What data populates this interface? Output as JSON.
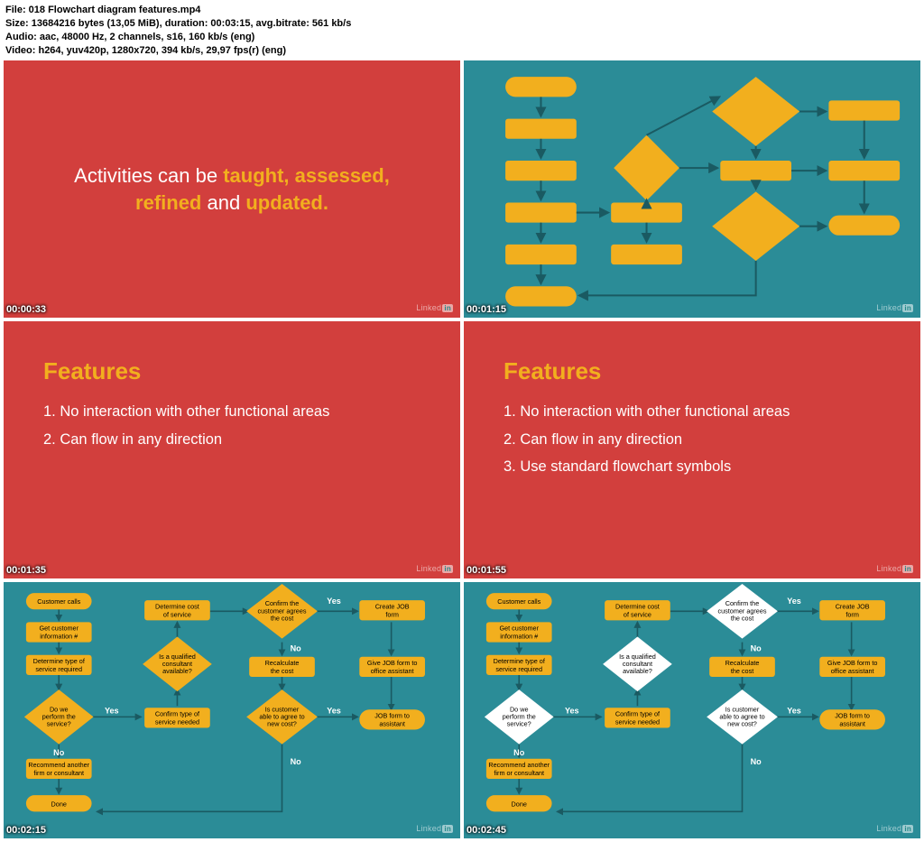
{
  "meta": {
    "file_line": "File: 018 Flowchart diagram features.mp4",
    "size_line": "Size: 13684216 bytes (13,05 MiB), duration: 00:03:15, avg.bitrate: 561 kb/s",
    "audio_line": "Audio: aac, 48000 Hz, 2 channels, s16, 160 kb/s (eng)",
    "video_line": "Video: h264, yuv420p, 1280x720, 394 kb/s, 29,97 fps(r) (eng)"
  },
  "linkedin_label": "Linked",
  "tiles": {
    "t1": {
      "timestamp": "00:00:33",
      "quote_pre": "Activities can be ",
      "quote_bold1": "taught, assessed, refined",
      "quote_mid": " and ",
      "quote_bold2": "updated.",
      "quote_end": ""
    },
    "t2": {
      "timestamp": "00:01:15"
    },
    "t3": {
      "timestamp": "00:01:35",
      "title": "Features",
      "items": [
        "1. No interaction with other functional areas",
        "2. Can flow in any direction"
      ]
    },
    "t4": {
      "timestamp": "00:01:55",
      "title": "Features",
      "items": [
        "1. No interaction with other functional areas",
        "2. Can flow in any direction",
        "3. Use standard flowchart symbols"
      ]
    },
    "t5": {
      "timestamp": "00:02:15"
    },
    "t6": {
      "timestamp": "00:02:45"
    }
  },
  "flowchart_nodes": {
    "n1": {
      "l1": "Customer calls"
    },
    "n2": {
      "l1": "Get customer",
      "l2": "information #"
    },
    "n3": {
      "l1": "Determine type of",
      "l2": "service required"
    },
    "n4": {
      "l1": "Do we",
      "l2": "perform the",
      "l3": "service?"
    },
    "n5": {
      "l1": "Recommend another",
      "l2": "firm or consultant"
    },
    "n6": {
      "l1": "Done"
    },
    "n7": {
      "l1": "Confirm type of",
      "l2": "service needed"
    },
    "n8": {
      "l1": "Is a qualified",
      "l2": "consultant",
      "l3": "available?"
    },
    "n9": {
      "l1": "Determine cost",
      "l2": "of service"
    },
    "n10": {
      "l1": "Confirm the",
      "l2": "customer agrees",
      "l3": "the cost"
    },
    "n11": {
      "l1": "Recalculate",
      "l2": "the cost"
    },
    "n12": {
      "l1": "Is customer",
      "l2": "able to agree to",
      "l3": "new cost?"
    },
    "n13": {
      "l1": "Create JOB",
      "l2": "form"
    },
    "n14": {
      "l1": "Give JOB form to",
      "l2": "office assistant"
    },
    "n15": {
      "l1": "JOB form to",
      "l2": "assistant"
    }
  },
  "labels": {
    "yes": "Yes",
    "no": "No"
  }
}
